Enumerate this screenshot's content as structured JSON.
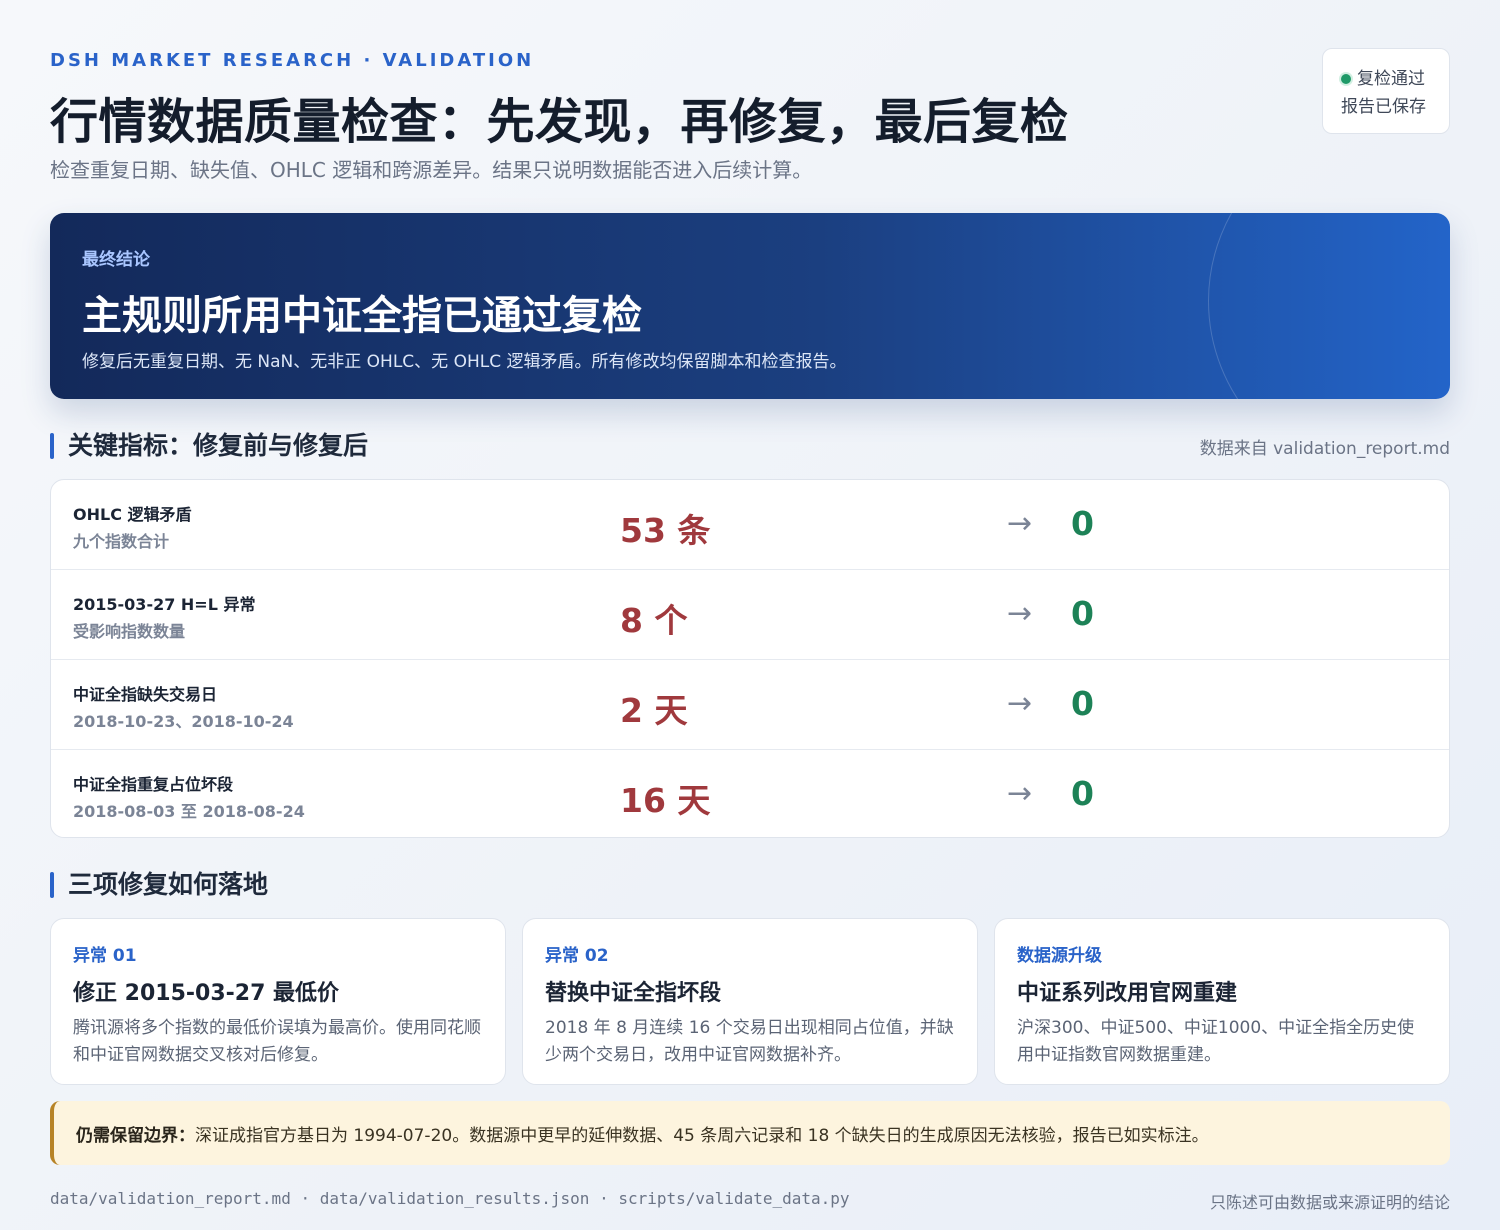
{
  "header": {
    "eyebrow": "DSH MARKET RESEARCH · VALIDATION",
    "title": "行情数据质量检查：先发现，再修复，最后复检",
    "subtitle": "检查重复日期、缺失值、OHLC 逻辑和跨源差异。结果只说明数据能否进入后续计算。"
  },
  "status": {
    "line1": "复检通过",
    "line2": "报告已保存",
    "color": "#1f9a68"
  },
  "conclusion": {
    "kicker": "最终结论",
    "title": "主规则所用中证全指已通过复检",
    "desc": "修复后无重复日期、无 NaN、无非正 OHLC、无 OHLC 逻辑矛盾。所有修改均保留脚本和检查报告。"
  },
  "metrics": {
    "heading": "关键指标：修复前与修复后",
    "source": "数据来自 validation_report.md",
    "arrow": "→",
    "rows": [
      {
        "label": "OHLC 逻辑矛盾",
        "sub": "九个指数合计",
        "before": "53 条",
        "after": "0"
      },
      {
        "label": "2015-03-27 H=L 异常",
        "sub": "受影响指数数量",
        "before": "8 个",
        "after": "0"
      },
      {
        "label": "中证全指缺失交易日",
        "sub": "2018-10-23、2018-10-24",
        "before": "2 天",
        "after": "0"
      },
      {
        "label": "中证全指重复占位坏段",
        "sub": "2018-08-03 至 2018-08-24",
        "before": "16 天",
        "after": "0"
      }
    ]
  },
  "fixes": {
    "heading": "三项修复如何落地",
    "cards": [
      {
        "tag": "异常 01",
        "title": "修正 2015-03-27 最低价",
        "desc": "腾讯源将多个指数的最低价误填为最高价。使用同花顺和中证官网数据交叉核对后修复。"
      },
      {
        "tag": "异常 02",
        "title": "替换中证全指坏段",
        "desc": "2018 年 8 月连续 16 个交易日出现相同占位值，并缺少两个交易日，改用中证官网数据补齐。"
      },
      {
        "tag": "数据源升级",
        "title": "中证系列改用官网重建",
        "desc": "沪深300、中证500、中证1000、中证全指全历史使用中证指数官网数据重建。"
      }
    ]
  },
  "caution": {
    "label": "仍需保留边界：",
    "text": "深证成指官方基日为 1994-07-20。数据源中更早的延伸数据、45 条周六记录和 18 个缺失日的生成原因无法核验，报告已如实标注。"
  },
  "footer": {
    "files": "data/validation_report.md · data/validation_results.json · scripts/validate_data.py",
    "note": "只陈述可由数据或来源证明的结论"
  },
  "colors": {
    "accent": "#2a63c9",
    "before": "#a0393d",
    "after": "#1d8257",
    "caution_border": "#b78326"
  }
}
